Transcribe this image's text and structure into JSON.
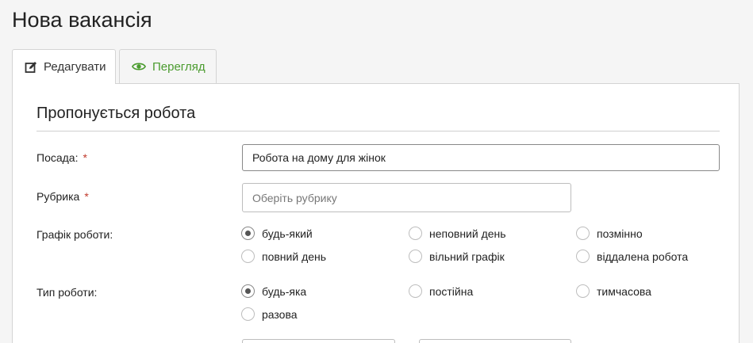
{
  "page": {
    "title": "Нова вакансія"
  },
  "tabs": [
    {
      "label": "Редагувати",
      "icon": "edit-icon",
      "active": true
    },
    {
      "label": "Перегляд",
      "icon": "eye-icon",
      "active": false
    }
  ],
  "form": {
    "section_title": "Пропонується робота",
    "position": {
      "label": "Посада:",
      "required_mark": "*",
      "value": "Робота на дому для жінок"
    },
    "category": {
      "label": "Рубрика",
      "required_mark": "*",
      "placeholder": "Оберіть рубрику"
    },
    "schedule": {
      "label": "Графік роботи:",
      "options": [
        {
          "label": "будь-який",
          "checked": true
        },
        {
          "label": "неповний день",
          "checked": false
        },
        {
          "label": "позмінно",
          "checked": false
        },
        {
          "label": "повний день",
          "checked": false
        },
        {
          "label": "вільний графік",
          "checked": false
        },
        {
          "label": "віддалена робота",
          "checked": false
        }
      ]
    },
    "work_type": {
      "label": "Тип роботи:",
      "options": [
        {
          "label": "будь-яка",
          "checked": true
        },
        {
          "label": "постійна",
          "checked": false
        },
        {
          "label": "тимчасова",
          "checked": false
        },
        {
          "label": "разова",
          "checked": false
        }
      ]
    }
  },
  "colors": {
    "accent_green": "#4a9b2e",
    "required_red": "#c0392b"
  }
}
